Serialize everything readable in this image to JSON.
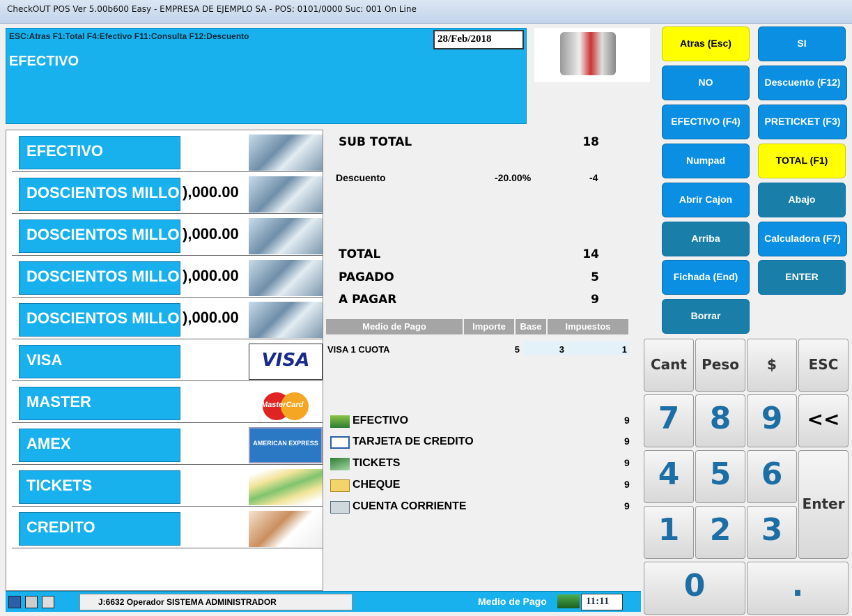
{
  "window": {
    "title": "CheckOUT POS Ver 5.00b600 Easy - EMPRESA DE EJEMPLO SA - POS: 0101/0000 Suc: 001  On Line"
  },
  "header": {
    "shortcuts": "ESC:Atras F1:Total F4:Efectivo F11:Consulta F12:Descuento",
    "mode": "EFECTIVO",
    "date": "28/Feb/2018"
  },
  "payments": [
    {
      "label": "EFECTIVO",
      "amount": "",
      "image": "money"
    },
    {
      "label": "DOSCIENTOS MILLONES",
      "amount": "),000.00",
      "image": "money"
    },
    {
      "label": "DOSCIENTOS MILLONES",
      "amount": "),000.00",
      "image": "money"
    },
    {
      "label": "DOSCIENTOS MILLONES",
      "amount": "),000.00",
      "image": "money"
    },
    {
      "label": "DOSCIENTOS MILLONES",
      "amount": "),000.00",
      "image": "money"
    },
    {
      "label": "VISA",
      "amount": "",
      "image": "visa",
      "image_text": "VISA"
    },
    {
      "label": "MASTER",
      "amount": "",
      "image": "mastercard",
      "image_text": "MasterCard"
    },
    {
      "label": "AMEX",
      "amount": "",
      "image": "amex",
      "image_text": "AMERICAN EXPRESS"
    },
    {
      "label": "TICKETS",
      "amount": "",
      "image": "tickets"
    },
    {
      "label": "CREDITO",
      "amount": "",
      "image": "credito"
    }
  ],
  "totals": {
    "subtotal_label": "SUB TOTAL",
    "subtotal": "18",
    "descuento_label": "Descuento",
    "descuento_pct": "-20.00%",
    "descuento": "-4",
    "total_label": "TOTAL",
    "total": "14",
    "pagado_label": "PAGADO",
    "pagado": "5",
    "apagar_label": "A PAGAR",
    "apagar": "9"
  },
  "table": {
    "headers": [
      "Medio de Pago",
      "Importe",
      "Base",
      "Impuestos"
    ],
    "rows": [
      [
        "VISA 1 CUOTA",
        "5",
        "3",
        "1"
      ]
    ]
  },
  "medios": [
    {
      "label": "EFECTIVO",
      "value": "9",
      "icon": "cash-icon"
    },
    {
      "label": "TARJETA DE CREDITO",
      "value": "9",
      "icon": "credit-card-icon"
    },
    {
      "label": "TICKETS",
      "value": "9",
      "icon": "tickets-icon"
    },
    {
      "label": "CHEQUE",
      "value": "9",
      "icon": "folder-icon"
    },
    {
      "label": "CUENTA CORRIENTE",
      "value": "9",
      "icon": "account-icon"
    }
  ],
  "buttons": {
    "atras": "Atras (Esc)",
    "si": "SI",
    "no": "NO",
    "descuento": "Descuento (F12)",
    "efectivo": "EFECTIVO (F4)",
    "preticket": "PRETICKET (F3)",
    "numpad": "Numpad",
    "total": "TOTAL (F1)",
    "abrir_cajon": "Abrir Cajon",
    "abajo": "Abajo",
    "arriba": "Arriba",
    "calculadora": "Calculadora (F7)",
    "fichada": "Fichada (End)",
    "enter": "ENTER",
    "borrar": "Borrar"
  },
  "keypad": {
    "cant": "Cant",
    "peso": "Peso",
    "dollar": "$",
    "esc": "ESC",
    "k7": "7",
    "k8": "8",
    "k9": "9",
    "back": "<<",
    "k4": "4",
    "k5": "5",
    "k6": "6",
    "enter": "Enter",
    "k1": "1",
    "k2": "2",
    "k3": "3",
    "k0": "0",
    "dot": "."
  },
  "status": {
    "operator": "J:6632 Operador  SISTEMA ADMINISTRADOR",
    "medio_label": "Medio de Pago",
    "time": "11:11"
  },
  "colors": {
    "panel_blue": "#18b1ee",
    "button_blue": "#0b8fe3",
    "button_teal": "#1a7fa8",
    "button_yellow": "#ffff00",
    "key_digit": "#1c6ea4"
  }
}
